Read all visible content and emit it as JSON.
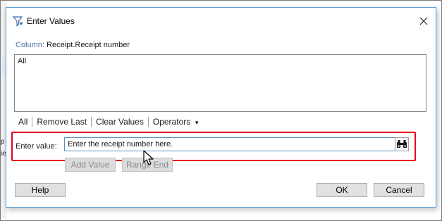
{
  "dialog": {
    "title": "Enter Values",
    "column_label": "Column:",
    "column_value": "Receipt.Receipt number",
    "values_list": [
      "All"
    ],
    "toolbar": {
      "all": "All",
      "remove_last": "Remove Last",
      "clear_values": "Clear Values",
      "operators": "Operators"
    },
    "enter_value": {
      "label": "Enter value:",
      "value": "Enter the receipt number here."
    },
    "buttons": {
      "add_value": "Add Value",
      "range_end": "Range End",
      "help": "Help",
      "ok": "OK",
      "cancel": "Cancel"
    }
  },
  "icons": {
    "title": "filter-funnel-icon",
    "close": "close-icon",
    "browse": "binoculars-icon",
    "operators_arrow": "caret-down-icon",
    "cursor": "mouse-pointer-icon"
  },
  "colors": {
    "highlight": "#e8001c",
    "dialog_border": "#5a9bd5",
    "column_label": "#4d6fa3"
  },
  "background_app": {
    "fragments": [
      "p",
      "ie"
    ]
  }
}
